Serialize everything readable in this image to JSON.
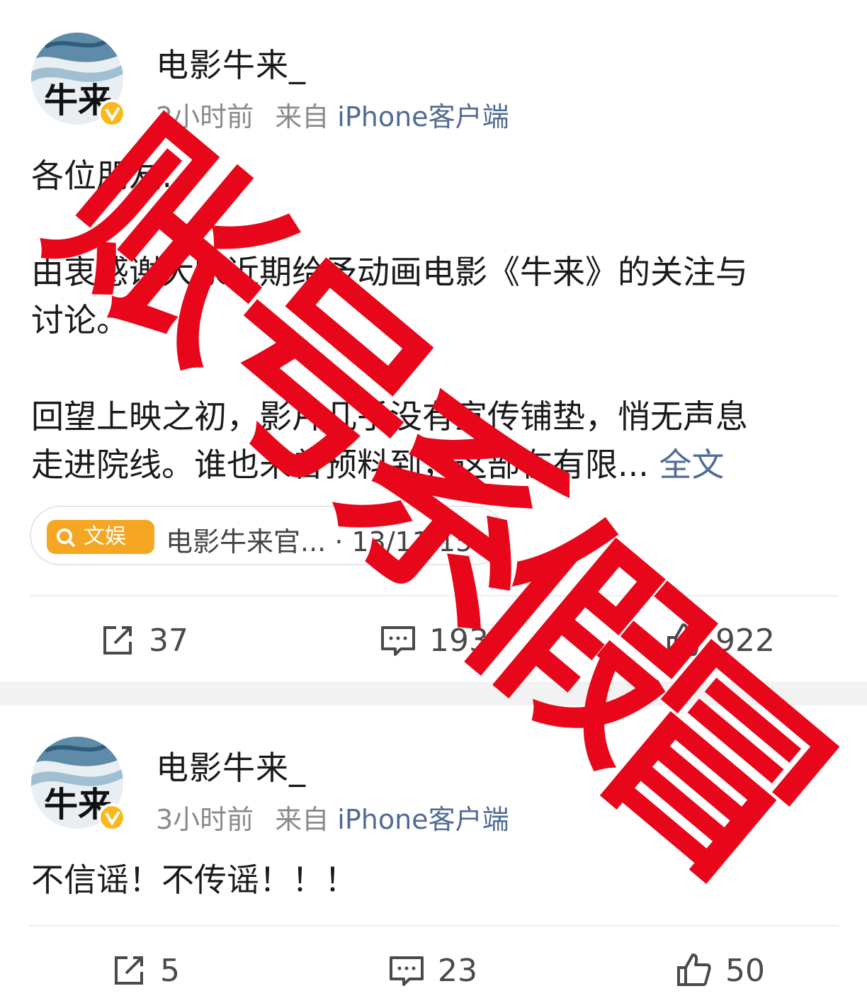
{
  "accent_colors": {
    "link": "#506b95",
    "verified": "#f9b81b",
    "tag": "#f5a623",
    "stamp": "#e8071a"
  },
  "posts": [
    {
      "username": "电影牛来_",
      "avatar_text": "牛来",
      "time": "2小时前",
      "source_prefix": "来自",
      "source_app": "iPhone客户端",
      "content_lines": [
        "各位朋友:",
        "",
        "由衷感谢大家近期给予动画电影《牛来》的关注与",
        "讨论。",
        "",
        "回望上映之初，影片几乎没有宣传铺垫，悄无声息",
        "走进院线。谁也未曾预料到，这部在有限..."
      ],
      "full_text_link": "全文",
      "card": {
        "tag_icon": "search-icon",
        "tag_label": "文娱",
        "title": "电影牛来官... · 13/11/15"
      },
      "reposts": "37",
      "comments": "193",
      "likes": "922"
    },
    {
      "username": "电影牛来_",
      "avatar_text": "牛来",
      "time": "3小时前",
      "source_prefix": "来自",
      "source_app": "iPhone客户端",
      "content_lines": [
        "不信谣！不传谣！！！"
      ],
      "reposts": "5",
      "comments": "23",
      "likes": "50"
    }
  ],
  "stamp": {
    "text": [
      "账",
      "号",
      "系",
      "假",
      "冒"
    ]
  }
}
